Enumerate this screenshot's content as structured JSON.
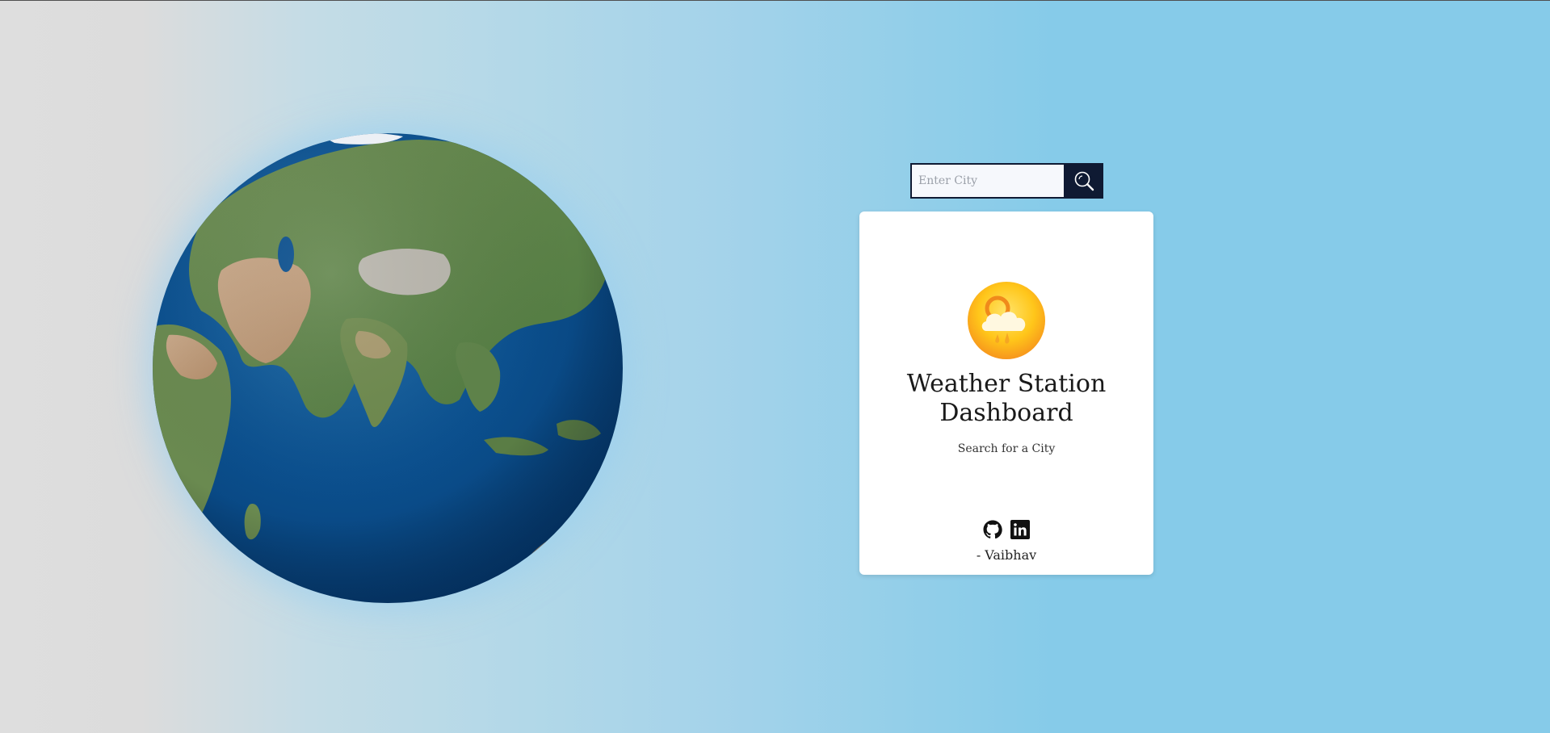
{
  "search": {
    "placeholder": "Enter City",
    "value": "",
    "button_icon": "search-icon"
  },
  "card": {
    "icon": "sun-rain-cloud-icon",
    "title": "Weather Station Dashboard",
    "subtitle": "Search for a City",
    "social": [
      {
        "icon": "github-icon"
      },
      {
        "icon": "linkedin-icon"
      }
    ],
    "author": "- Vaibhav"
  },
  "globe": {
    "icon": "earth-globe-image"
  },
  "colors": {
    "search_accent": "#0f1a33",
    "background_left": "#dedede",
    "background_right": "#86cbe9",
    "ocean": "#0a4f8f",
    "sun": "#ffc61a"
  }
}
